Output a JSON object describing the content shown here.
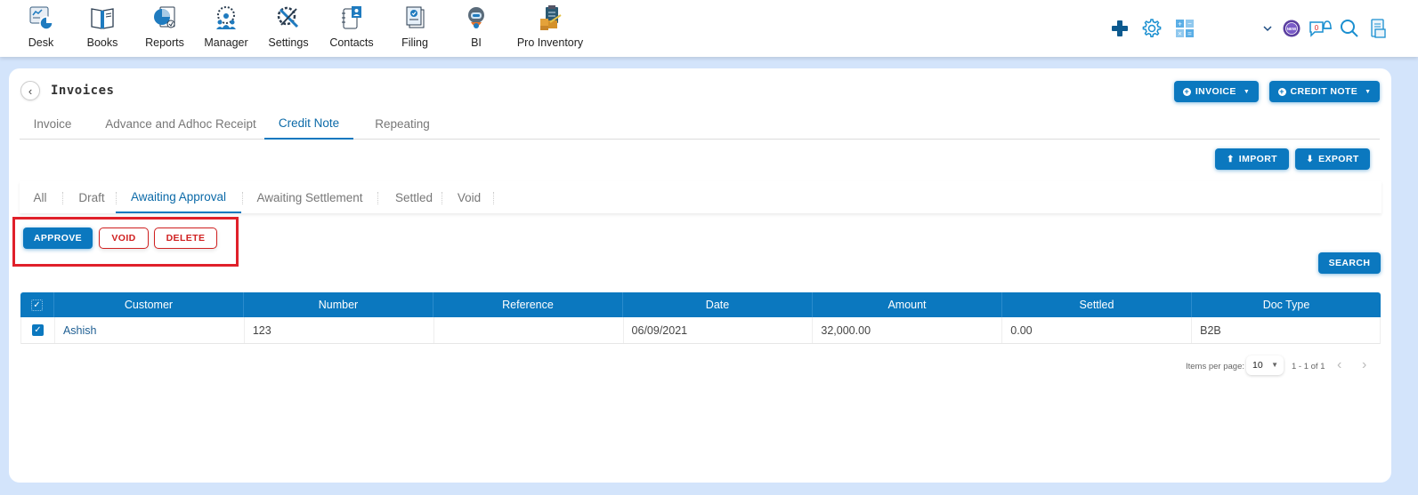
{
  "topnav": {
    "items": [
      {
        "label": "Desk",
        "icon": "desk-icon"
      },
      {
        "label": "Books",
        "icon": "books-icon"
      },
      {
        "label": "Reports",
        "icon": "reports-icon"
      },
      {
        "label": "Manager",
        "icon": "manager-icon"
      },
      {
        "label": "Settings",
        "icon": "settings-tools-icon"
      },
      {
        "label": "Contacts",
        "icon": "contacts-icon"
      },
      {
        "label": "Filing",
        "icon": "filing-icon"
      },
      {
        "label": "BI",
        "icon": "bi-robot-icon"
      },
      {
        "label": "Pro Inventory",
        "icon": "pro-inventory-icon"
      }
    ],
    "right_icons": [
      "plus-icon",
      "gear-icon",
      "calculator-icon",
      "chevron-down-icon",
      "new-badge-icon",
      "notification-icon",
      "search-icon",
      "clipboard-icon"
    ],
    "notification_count": "0",
    "new_badge_text": "NEW"
  },
  "page": {
    "title": "Invoices",
    "invoice_button": "INVOICE",
    "credit_note_button": "CREDIT NOTE",
    "import_button": "IMPORT",
    "export_button": "EXPORT",
    "search_button": "SEARCH"
  },
  "main_tabs": [
    {
      "label": "Invoice",
      "active": false
    },
    {
      "label": "Advance and Adhoc Receipt",
      "active": false
    },
    {
      "label": "Credit Note",
      "active": true
    },
    {
      "label": "Repeating",
      "active": false
    }
  ],
  "status_tabs": [
    {
      "label": "All",
      "active": false
    },
    {
      "label": "Draft",
      "active": false
    },
    {
      "label": "Awaiting Approval",
      "active": true
    },
    {
      "label": "Awaiting Settlement",
      "active": false
    },
    {
      "label": "Settled",
      "active": false
    },
    {
      "label": "Void",
      "active": false
    }
  ],
  "actions": {
    "approve": "APPROVE",
    "void": "VOID",
    "delete": "DELETE"
  },
  "colors": {
    "primary": "#0b78bf",
    "danger": "#d02020",
    "highlight": "#e0202a",
    "background": "#d3e4fb"
  },
  "table": {
    "columns": [
      "Customer",
      "Number",
      "Reference",
      "Date",
      "Amount",
      "Settled",
      "Doc Type"
    ],
    "rows": [
      {
        "checked": true,
        "customer": "Ashish",
        "number": "123",
        "reference": "",
        "date": "06/09/2021",
        "amount": "32,000.00",
        "settled": "0.00",
        "doc_type": "B2B"
      }
    ]
  },
  "pagination": {
    "items_per_page_label": "Items per page:",
    "items_per_page": "10",
    "range": "1 - 1 of 1"
  }
}
